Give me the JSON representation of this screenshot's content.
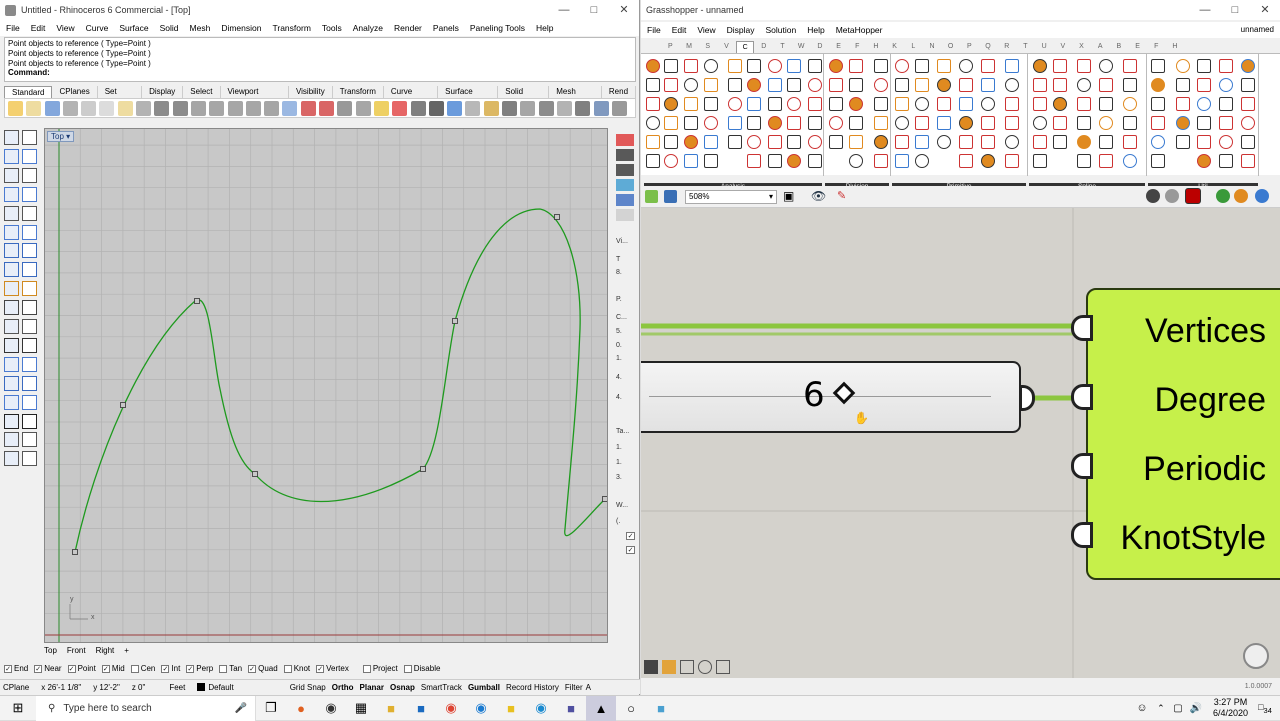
{
  "rhino": {
    "title": "Untitled - Rhinoceros 6 Commercial - [Top]",
    "menu": [
      "File",
      "Edit",
      "View",
      "Curve",
      "Surface",
      "Solid",
      "Mesh",
      "Dimension",
      "Transform",
      "Tools",
      "Analyze",
      "Render",
      "Panels",
      "Paneling Tools",
      "Help"
    ],
    "command_history": [
      "Point objects to reference ( Type=Point )",
      "Point objects to reference ( Type=Point )",
      "Point objects to reference ( Type=Point )"
    ],
    "command_prompt": "Command:",
    "toolbar_tabs": [
      "Standard",
      "CPlanes",
      "Set View",
      "Display",
      "Select",
      "Viewport Layout",
      "Visibility",
      "Transform",
      "Curve Tools",
      "Surface Tools",
      "Solid Tools",
      "Mesh Tools",
      "Rend"
    ],
    "viewport_label": "Top",
    "viewport_tabs": [
      "Top",
      "Front",
      "Right"
    ],
    "panel_fragments": [
      "Vi...",
      "T",
      "8.",
      "P.",
      "C...",
      "5.",
      "0.",
      "1.",
      "4.",
      "4.",
      "Ta...",
      "1.",
      "1.",
      "3.",
      "W...",
      "(."
    ],
    "osnaps": [
      {
        "label": "End",
        "checked": true
      },
      {
        "label": "Near",
        "checked": true
      },
      {
        "label": "Point",
        "checked": true
      },
      {
        "label": "Mid",
        "checked": true
      },
      {
        "label": "Cen",
        "checked": false
      },
      {
        "label": "Int",
        "checked": true
      },
      {
        "label": "Perp",
        "checked": true
      },
      {
        "label": "Tan",
        "checked": false
      },
      {
        "label": "Quad",
        "checked": true
      },
      {
        "label": "Knot",
        "checked": false
      },
      {
        "label": "Vertex",
        "checked": true
      },
      {
        "label": "Project",
        "checked": false
      },
      {
        "label": "Disable",
        "checked": false
      }
    ],
    "status": {
      "cplane": "CPlane",
      "x": "x 26'-1 1/8\"",
      "y": "y 12'-2\"",
      "z": "z 0\"",
      "units": "Feet",
      "layer": "Default",
      "grid_snap": "Grid Snap",
      "ortho": "Ortho",
      "planar": "Planar",
      "osnap": "Osnap",
      "smarttrack": "SmartTrack",
      "gumball": "Gumball",
      "record_history": "Record History",
      "filter": "Filter",
      "extra": "A"
    },
    "axis_y": "y",
    "axis_x": "x",
    "curve_color": "#1e9a1e"
  },
  "grasshopper": {
    "title": "Grasshopper - unnamed",
    "doc_name": "unnamed",
    "menu": [
      "File",
      "Edit",
      "View",
      "Display",
      "Solution",
      "Help",
      "MetaHopper"
    ],
    "tabs": [
      "P",
      "M",
      "S",
      "V",
      "C",
      "D",
      "T",
      "W",
      "D",
      "E",
      "F",
      "H",
      "K",
      "L",
      "N",
      "O",
      "P",
      "Q",
      "R",
      "T",
      "U",
      "V",
      "X",
      "A",
      "B",
      "E",
      "F",
      "H"
    ],
    "active_tab_index": 4,
    "groups": [
      "Analysis",
      "Division",
      "Primitive",
      "Spline",
      "Util"
    ],
    "zoom": "508%",
    "slider_value": "6",
    "inputs": [
      "Vertices",
      "Degree",
      "Periodic",
      "KnotStyle"
    ],
    "version": "1.0.0007",
    "accent": "#c6f04a",
    "wire_color": "#8cc63f"
  },
  "taskbar": {
    "search_placeholder": "Type here to search",
    "time": "3:27 PM",
    "date": "6/4/2020",
    "notification_count": "34"
  }
}
